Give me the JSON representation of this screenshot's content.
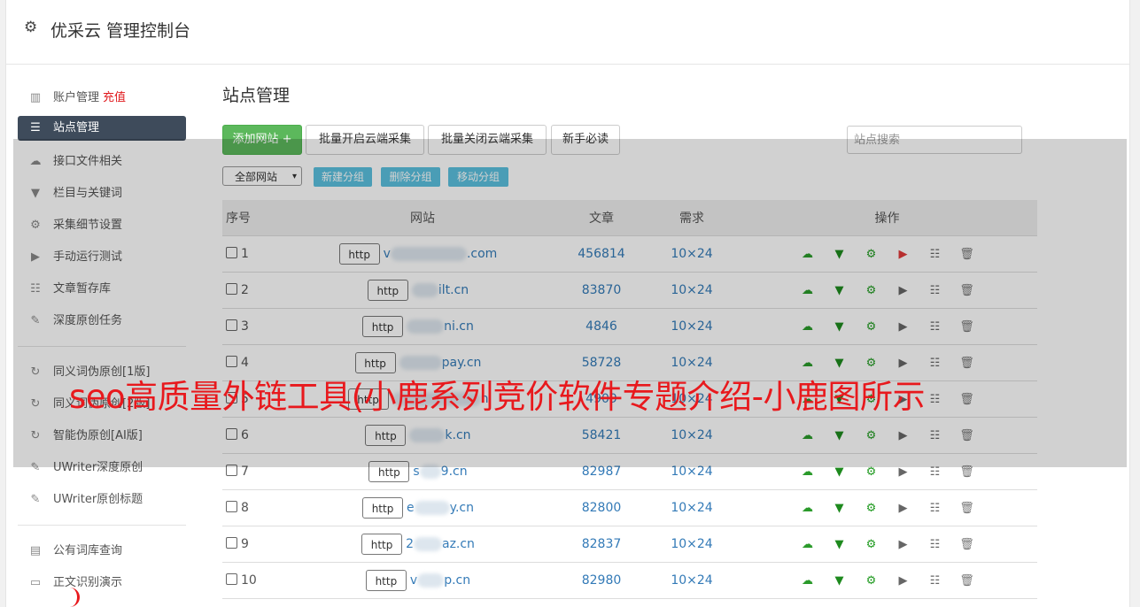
{
  "header": {
    "title": "优采云 管理控制台",
    "icon": "gear-icon"
  },
  "sidebar": {
    "items": [
      {
        "label": "账户管理",
        "extra": "充值",
        "icon": "bar-chart-icon"
      },
      {
        "label": "站点管理",
        "icon": "server-icon",
        "active": true
      },
      {
        "label": "接口文件相关",
        "icon": "cloud-upload-icon"
      },
      {
        "label": "栏目与关键词",
        "icon": "filter-icon"
      },
      {
        "label": "采集细节设置",
        "icon": "gears-icon"
      },
      {
        "label": "手动运行测试",
        "icon": "play-circle-icon"
      },
      {
        "label": "文章暂存库",
        "icon": "database-icon"
      },
      {
        "label": "深度原创任务",
        "icon": "edit-icon"
      },
      {
        "label": "同义词伪原创[1版]",
        "icon": "refresh-icon"
      },
      {
        "label": "同义词伪原创[2版]",
        "icon": "refresh-icon"
      },
      {
        "label": "智能伪原创[AI版]",
        "icon": "refresh-icon"
      },
      {
        "label": "UWriter深度原创",
        "icon": "edit-icon"
      },
      {
        "label": "UWriter原创标题",
        "icon": "edit-icon"
      },
      {
        "label": "公有词库查询",
        "icon": "book-icon"
      },
      {
        "label": "正文识别演示",
        "icon": "monitor-icon"
      }
    ]
  },
  "main": {
    "title": "站点管理",
    "toolbar": {
      "add": "添加网站 +",
      "batch_open": "批量开启云端采集",
      "batch_close": "批量关闭云端采集",
      "guide": "新手必读",
      "search_placeholder": "站点搜索"
    },
    "group": {
      "select_value": "全部网站",
      "new_group": "新建分组",
      "delete_group": "删除分组",
      "move_group": "移动分组"
    },
    "table": {
      "headers": [
        "序号",
        "网站",
        "文章",
        "需求",
        "操作"
      ],
      "rows": [
        {
          "no": "1",
          "proto": "http",
          "prefix": "v",
          "suffix": ".com",
          "articles": "456814",
          "demand": "10×24",
          "running": true
        },
        {
          "no": "2",
          "proto": "http",
          "prefix": "",
          "suffix": "ilt.cn",
          "articles": "83870",
          "demand": "10×24",
          "running": false
        },
        {
          "no": "3",
          "proto": "http",
          "prefix": "",
          "suffix": "ni.cn",
          "articles": "4846",
          "demand": "10×24",
          "running": false
        },
        {
          "no": "4",
          "proto": "http",
          "prefix": "",
          "suffix": "pay.cn",
          "articles": "58728",
          "demand": "10×24",
          "running": false
        },
        {
          "no": "5",
          "proto": "http",
          "prefix": "",
          "suffix": "n",
          "articles": "4909",
          "demand": "10×24",
          "running": false
        },
        {
          "no": "6",
          "proto": "http",
          "prefix": "",
          "suffix": "k.cn",
          "articles": "58421",
          "demand": "10×24",
          "running": false
        },
        {
          "no": "7",
          "proto": "http",
          "prefix": "s",
          "suffix": "9.cn",
          "articles": "82987",
          "demand": "10×24",
          "running": false
        },
        {
          "no": "8",
          "proto": "http",
          "prefix": "e",
          "suffix": "y.cn",
          "articles": "82800",
          "demand": "10×24",
          "running": false
        },
        {
          "no": "9",
          "proto": "http",
          "prefix": "2",
          "suffix": "az.cn",
          "articles": "82837",
          "demand": "10×24",
          "running": false
        },
        {
          "no": "10",
          "proto": "http",
          "prefix": "v",
          "suffix": "p.cn",
          "articles": "82980",
          "demand": "10×24",
          "running": false
        }
      ]
    }
  },
  "overlay": {
    "caption": "seo高质量外链工具(小鹿系列竞价软件专题介绍-小鹿图所示"
  },
  "colors": {
    "accent_green": "#5cb85c",
    "info_blue": "#5bc0de",
    "caption_red": "#e8191d",
    "active_nav": "#3e4b5b"
  }
}
